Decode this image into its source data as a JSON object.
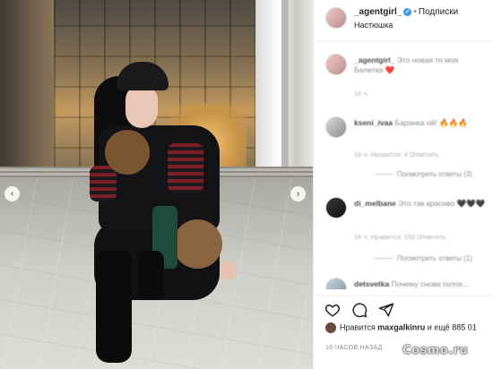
{
  "post": {
    "username": "_agentgirl_",
    "follow_label": "Подписки",
    "location": "Настюшка",
    "verified": true
  },
  "photo": {
    "prev_glyph": "‹",
    "next_glyph": "›"
  },
  "comments": [
    {
      "author": "_agentgirl_",
      "text": "Это новая то моя Балетка ❤️",
      "meta": "16 ч."
    },
    {
      "author": "kseni_ivaa",
      "text": "Баранка ой! 🔥🔥🔥",
      "meta": "16 ч.   Нравится: 4   Ответить",
      "more": "Посмотреть ответы (3)"
    },
    {
      "author": "di_melbane",
      "text": "Это так красиво 🖤🖤🖤",
      "meta": "16 ч.   Нравится: 152   Ответить",
      "more": "Посмотреть ответы (1)"
    },
    {
      "author": "detsvetka",
      "text": "Почему снова голое..."
    }
  ],
  "actions": {
    "like_icon": "heart-icon",
    "comment_icon": "comment-icon",
    "share_icon": "share-icon",
    "save_icon": "bookmark-icon"
  },
  "likes": {
    "prefix": "Нравится",
    "user": "maxgalkinru",
    "suffix": "и ещё 885 01"
  },
  "timestamp": "16 ЧАСОВ НАЗАД",
  "watermark": "Cosmo.ru"
}
